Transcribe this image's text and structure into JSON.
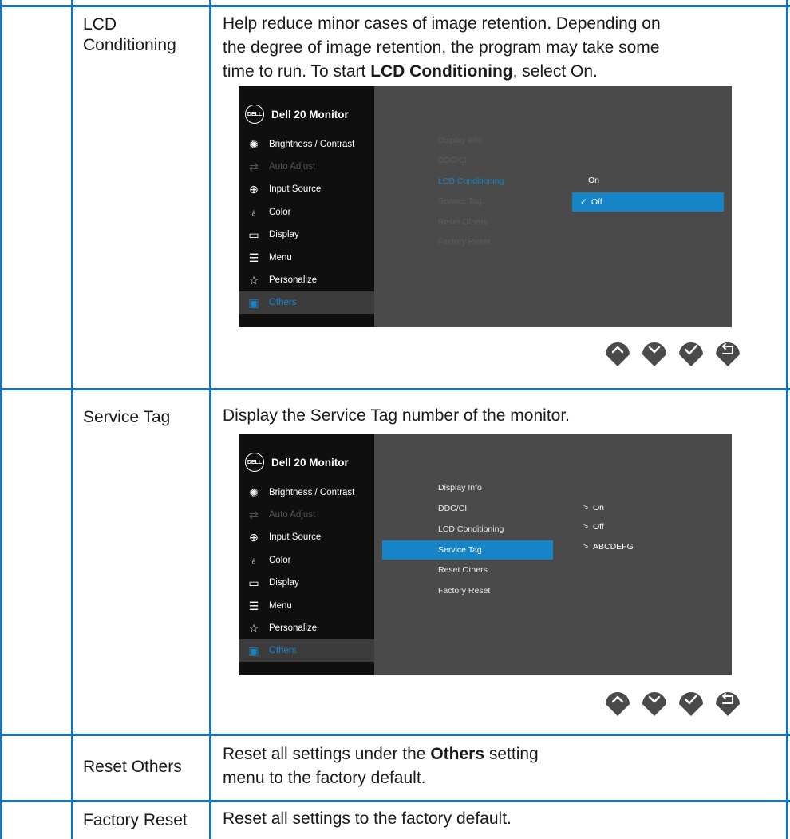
{
  "rows": [
    {
      "label": "LCD\nConditioning",
      "desc_lines": [
        "Help reduce minor cases of image retention. Depending on",
        "the degree of image retention, the program may take some"
      ],
      "desc_last_pre": "time to run. To start ",
      "desc_last_bold": "LCD Conditioning",
      "desc_last_post": ", select On."
    },
    {
      "label": "Service Tag",
      "desc": "Display the Service Tag number of the monitor."
    },
    {
      "label": "Reset Others",
      "desc_pre": "Reset all settings under the ",
      "desc_bold": "Others",
      "desc_post": " setting",
      "desc_line2": "menu to the factory default."
    },
    {
      "label": "Factory Reset",
      "desc": "Reset all settings to the factory default."
    }
  ],
  "osd": {
    "logo": "DELL",
    "title": "Dell 20 Monitor",
    "menu": [
      {
        "label": "Brightness / Contrast",
        "icon": "brightness-icon",
        "state": "normal"
      },
      {
        "label": "Auto Adjust",
        "icon": "auto-adjust-icon",
        "state": "disabled"
      },
      {
        "label": "Input Source",
        "icon": "input-source-icon",
        "state": "normal"
      },
      {
        "label": "Color",
        "icon": "color-icon",
        "state": "normal"
      },
      {
        "label": "Display",
        "icon": "display-icon",
        "state": "normal"
      },
      {
        "label": "Menu",
        "icon": "menu-icon",
        "state": "normal"
      },
      {
        "label": "Personalize",
        "icon": "personalize-icon",
        "state": "normal"
      },
      {
        "label": "Others",
        "icon": "others-icon",
        "state": "selected"
      }
    ],
    "submenu": [
      "Display Info",
      "DDC/CI",
      "LCD Conditioning",
      "Service Tag",
      "Reset Others",
      "Factory Reset"
    ],
    "lcd_options": {
      "on": "On",
      "off": "Off"
    },
    "values": [
      "On",
      "Off",
      "ABCDEFG"
    ]
  },
  "buttons": [
    "up-button",
    "down-button",
    "ok-button",
    "back-button"
  ],
  "colors": {
    "accent": "#1585c7",
    "border": "#1a73b8",
    "osd_bg": "#4a4a4a",
    "osd_left": "#0f0f0f"
  }
}
